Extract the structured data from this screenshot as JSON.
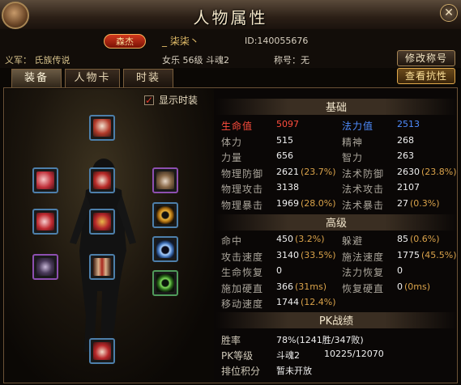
{
  "window": {
    "title": "人物属性",
    "close_symbol": "✕"
  },
  "header": {
    "faction_badge": "森杰",
    "name": "_ 柒柒丶",
    "id_text": "ID:140055676",
    "guild_text": "义军： 氏族传说",
    "level_text": "女乐 56级 斗魂2",
    "title_text": "称号：无",
    "rename_title_button": "修改称号",
    "view_resist_button": "查看抗性"
  },
  "tabs": [
    {
      "label": "装备",
      "active": true
    },
    {
      "label": "人物卡",
      "active": false
    },
    {
      "label": "时装",
      "active": false
    }
  ],
  "equip": {
    "show_fashion_label": "显示时装",
    "show_fashion_checked": true,
    "slots": [
      {
        "icon": "helmet-icon",
        "border": "blue"
      },
      {
        "icon": "shoulder-icon",
        "border": "blue"
      },
      {
        "icon": "armor-icon",
        "border": "blue"
      },
      {
        "icon": "necklace-icon",
        "border": "purple"
      },
      {
        "icon": "gloves-icon",
        "border": "blue"
      },
      {
        "icon": "belt-icon",
        "border": "blue"
      },
      {
        "icon": "bracelet-icon",
        "border": "blue"
      },
      {
        "icon": "ring-icon",
        "border": "blue"
      },
      {
        "icon": "talisman-icon",
        "border": "purple"
      },
      {
        "icon": "pants-icon",
        "border": "blue"
      },
      {
        "icon": "jade-ring-icon",
        "border": "green"
      },
      {
        "icon": "boots-icon",
        "border": "blue"
      }
    ]
  },
  "stats": {
    "basic_title": "基础",
    "basic": [
      {
        "l1": "生命值",
        "v1": "5097",
        "p1": "",
        "l2": "法力值",
        "v2": "2513",
        "p2": "",
        "c1": "red",
        "c2": "blue"
      },
      {
        "l1": "体力",
        "v1": "515",
        "p1": "",
        "l2": "精神",
        "v2": "268",
        "p2": ""
      },
      {
        "l1": "力量",
        "v1": "656",
        "p1": "",
        "l2": "智力",
        "v2": "263",
        "p2": ""
      },
      {
        "l1": "物理防御",
        "v1": "2621",
        "p1": "(23.7%)",
        "l2": "法术防御",
        "v2": "2630",
        "p2": "(23.8%)"
      },
      {
        "l1": "物理攻击",
        "v1": "3138",
        "p1": "",
        "l2": "法术攻击",
        "v2": "2107",
        "p2": ""
      },
      {
        "l1": "物理暴击",
        "v1": "1969",
        "p1": "(28.0%)",
        "l2": "法术暴击",
        "v2": "27",
        "p2": "(0.3%)"
      }
    ],
    "advanced_title": "高级",
    "advanced": [
      {
        "l1": "命中",
        "v1": "450",
        "p1": "(3.2%)",
        "l2": "躲避",
        "v2": "85",
        "p2": "(0.6%)"
      },
      {
        "l1": "攻击速度",
        "v1": "3140",
        "p1": "(33.5%)",
        "l2": "施法速度",
        "v2": "1775",
        "p2": "(45.5%)"
      },
      {
        "l1": "生命恢复",
        "v1": "0",
        "p1": "",
        "l2": "法力恢复",
        "v2": "0",
        "p2": ""
      },
      {
        "l1": "施加硬直",
        "v1": "366",
        "p1": "(31ms)",
        "l2": "恢复硬直",
        "v2": "0",
        "p2": "(0ms)"
      },
      {
        "l1": "移动速度",
        "v1": "1744",
        "p1": "(12.4%)",
        "l2": "",
        "v2": "",
        "p2": ""
      }
    ],
    "pk_title": "PK战绩",
    "pk": [
      {
        "label": "胜率",
        "value": "78%(1241胜/347败)",
        "extra": ""
      },
      {
        "label": "PK等级",
        "value": "斗魂2",
        "extra": "10225/12070"
      },
      {
        "label": "排位积分",
        "value": "暂未开放",
        "extra": ""
      }
    ]
  }
}
